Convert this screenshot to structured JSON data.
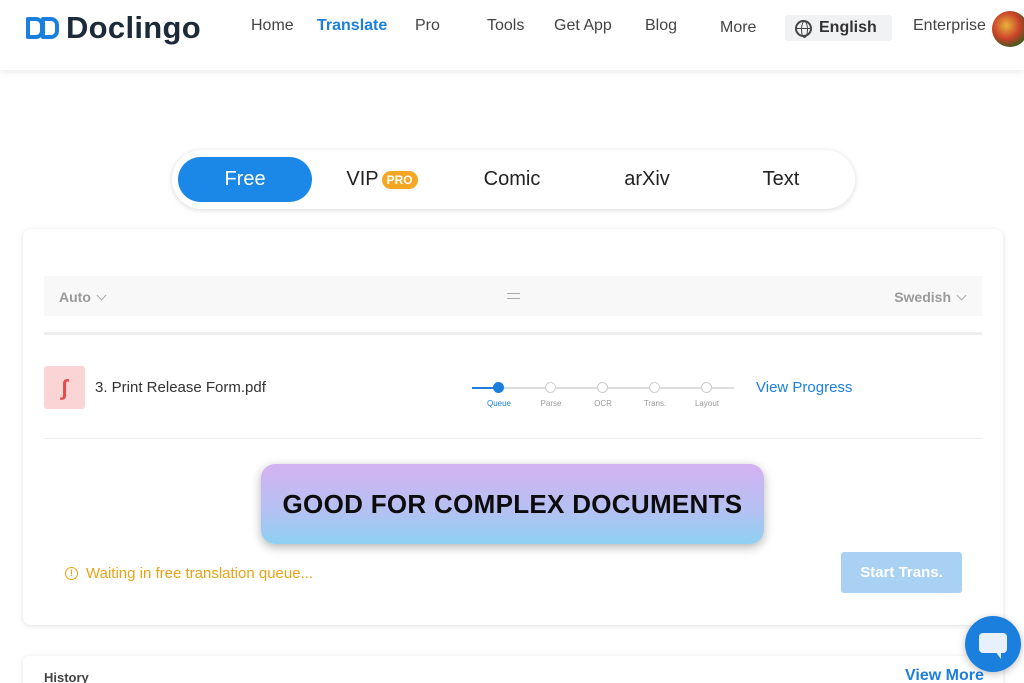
{
  "brand": {
    "name": "Doclingo",
    "accent": "#1b7fde"
  },
  "nav": {
    "items": [
      {
        "label": "Home",
        "active": false
      },
      {
        "label": "Translate",
        "active": true
      },
      {
        "label": "Pro",
        "active": false
      },
      {
        "label": "Tools",
        "active": false
      },
      {
        "label": "Get App",
        "active": false
      },
      {
        "label": "Blog",
        "active": false
      },
      {
        "label": "More",
        "active": false
      }
    ],
    "language": "English",
    "enterprise": "Enterprise"
  },
  "modes": {
    "tabs": [
      {
        "label": "Free",
        "active": true
      },
      {
        "label": "VIP",
        "badge": "PRO",
        "active": false
      },
      {
        "label": "Comic",
        "active": false
      },
      {
        "label": "arXiv",
        "active": false
      },
      {
        "label": "Text",
        "active": false
      }
    ]
  },
  "translator": {
    "source_lang": "Auto",
    "target_lang": "Swedish",
    "file": {
      "name": "3. Print Release Form.pdf",
      "steps": [
        "Queue",
        "Parse",
        "OCR",
        "Trans.",
        "Layout"
      ],
      "current_step": 0,
      "view_progress": "View Progress"
    },
    "banner": "GOOD FOR COMPLEX DOCUMENTS",
    "queue_message": "Waiting in free translation queue...",
    "start_button": "Start Trans."
  },
  "history": {
    "title": "History",
    "view_more": "View More"
  },
  "icons": [
    "logo-mark-icon",
    "globe-icon",
    "pdf-icon",
    "swap-icon",
    "chevron-down-icon",
    "warning-icon",
    "chat-icon"
  ]
}
